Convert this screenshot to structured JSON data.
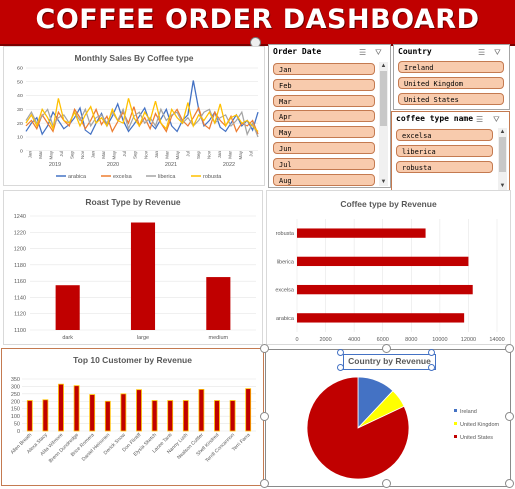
{
  "dashboard": {
    "title": "COFFEE ORDER DASHBOARD"
  },
  "slicers": {
    "order_date": {
      "title": "Order Date",
      "items": [
        "Jan",
        "Feb",
        "Mar",
        "Apr",
        "May",
        "Jun",
        "Jul",
        "Aug"
      ]
    },
    "country": {
      "title": "Country",
      "items": [
        "Ireland",
        "United Kingdom",
        "United States"
      ]
    },
    "coffee_type": {
      "title": "coffee type name",
      "items": [
        "excelsa",
        "liberica",
        "robusta"
      ]
    }
  },
  "colors": {
    "accent": "#c00000",
    "arabica": "#4472c4",
    "excelsa": "#ed7d31",
    "liberica": "#a5a5a5",
    "robusta": "#ffc000",
    "slicer_item": "#f8cbad"
  },
  "chart_data": [
    {
      "type": "line",
      "title": "Monthly Sales By Coffee type",
      "ylim": [
        0,
        60
      ],
      "yticks": [
        "0",
        "10",
        "20",
        "30",
        "40",
        "50",
        "60"
      ],
      "x_month_labels": [
        "Jan",
        "Mar",
        "May",
        "Jul",
        "Sep",
        "Nov",
        "Jan",
        "Mar",
        "May",
        "Jul",
        "Sep",
        "Nov",
        "Jan",
        "Mar",
        "May",
        "Jul",
        "Sep",
        "Nov",
        "Jan",
        "Mar",
        "May",
        "Jul"
      ],
      "x_year_labels": [
        "2019",
        "2020",
        "2021",
        "2022"
      ],
      "series": [
        {
          "name": "arabica",
          "legend": "arabica",
          "color": "#4472c4",
          "values": [
            14,
            20,
            24,
            12,
            18,
            28,
            22,
            16,
            19,
            24,
            31,
            15,
            12,
            20,
            27,
            18,
            25,
            34,
            22,
            14,
            19,
            25,
            31,
            20,
            16,
            23,
            30,
            18,
            14,
            22,
            26,
            51,
            30,
            18,
            22,
            28,
            17,
            14,
            20,
            26,
            18,
            22,
            15,
            28
          ]
        },
        {
          "name": "excelsa",
          "legend": "excelsa",
          "color": "#ed7d31",
          "values": [
            18,
            22,
            16,
            26,
            20,
            14,
            28,
            22,
            18,
            30,
            24,
            16,
            22,
            30,
            19,
            25,
            14,
            21,
            28,
            20,
            32,
            18,
            24,
            16,
            27,
            20,
            14,
            25,
            30,
            22,
            18,
            24,
            31,
            19,
            16,
            28,
            22,
            18,
            25,
            14,
            20,
            18,
            22,
            12
          ]
        },
        {
          "name": "liberica",
          "legend": "liberica",
          "color": "#a5a5a5",
          "values": [
            22,
            28,
            20,
            25,
            30,
            18,
            24,
            26,
            20,
            28,
            22,
            30,
            18,
            24,
            26,
            20,
            28,
            22,
            30,
            16,
            25,
            28,
            20,
            24,
            18,
            30,
            22,
            26,
            28,
            20,
            24,
            18,
            22,
            28,
            30,
            20,
            24,
            26,
            18,
            22,
            28,
            12,
            20,
            10
          ]
        },
        {
          "name": "robusta",
          "legend": "robusta",
          "color": "#ffc000",
          "values": [
            20,
            26,
            18,
            30,
            24,
            16,
            38,
            22,
            20,
            28,
            18,
            26,
            32,
            20,
            24,
            18,
            30,
            22,
            20,
            38,
            24,
            18,
            28,
            22,
            36,
            20,
            16,
            30,
            24,
            20,
            35,
            18,
            26,
            22,
            28,
            20,
            34,
            18,
            24,
            26,
            20,
            22,
            18,
            14
          ]
        }
      ]
    },
    {
      "type": "bar",
      "title": "Roast Type by Revenue",
      "categories": [
        "dark",
        "large",
        "medium"
      ],
      "values": [
        1155,
        1232,
        1165
      ],
      "ylim": [
        1100,
        1240
      ],
      "yticks": [
        "1100",
        "1120",
        "1140",
        "1160",
        "1180",
        "1200",
        "1220",
        "1240"
      ]
    },
    {
      "type": "bar",
      "orientation": "horizontal",
      "title": "Coffee type by Revenue",
      "categories": [
        "robusta",
        "liberica",
        "excelsa",
        "arabica"
      ],
      "values": [
        9000,
        12000,
        12300,
        11700
      ],
      "xlim": [
        0,
        14000
      ],
      "xticks": [
        "0",
        "2000",
        "4000",
        "6000",
        "8000",
        "10000",
        "12000",
        "14000"
      ]
    },
    {
      "type": "bar",
      "title": "Top 10 Customer by Revenue",
      "categories": [
        "Allen Breath",
        "Alexa Stacy",
        "Alita Wilmore",
        "Brenn Dundredge",
        "Brice Romera",
        "Daniel Heinonen",
        "Derick Snow",
        "Don Flintiff",
        "Elysia Sketch",
        "Lacee Tanti",
        "Nanny Lush",
        "Nealson Cuttler",
        "Shell Kindred",
        "Terrill Concannon",
        "Terri Farra"
      ],
      "values": [
        205,
        210,
        315,
        305,
        245,
        200,
        250,
        278,
        205,
        205,
        205,
        280,
        205,
        205,
        285
      ],
      "ylim": [
        0,
        350
      ],
      "yticks": [
        "0",
        "50",
        "100",
        "150",
        "200",
        "250",
        "300",
        "350"
      ]
    },
    {
      "type": "pie",
      "title": "Country by Revenue",
      "categories": [
        "Ireland",
        "United Kingdom",
        "United States"
      ],
      "values": [
        12,
        6,
        82
      ],
      "colors": [
        "#4472c4",
        "#ffff00",
        "#c00000"
      ],
      "legend_position": "right"
    }
  ]
}
